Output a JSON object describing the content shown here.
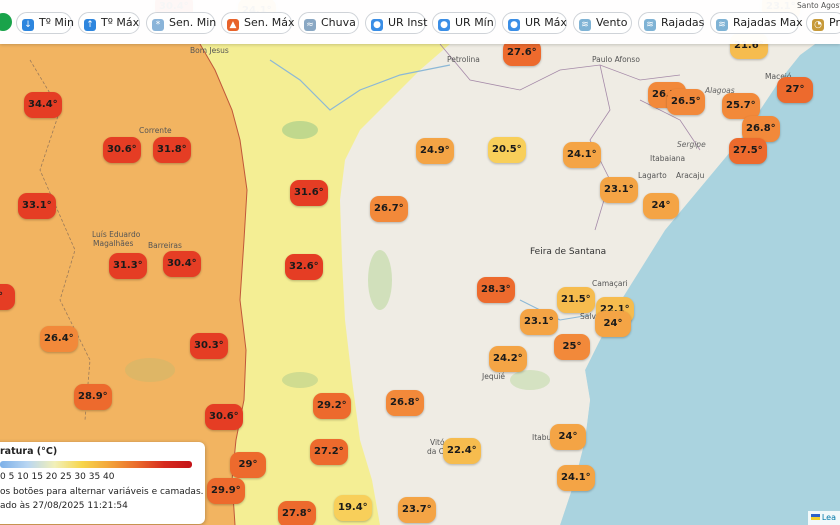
{
  "toolbar": {
    "buttons": [
      {
        "label": "Tº Min",
        "icon": "thermometer-down-icon"
      },
      {
        "label": "Tº Máx",
        "icon": "thermometer-up-icon"
      },
      {
        "label": "Sen. Min",
        "icon": "snowflake-icon"
      },
      {
        "label": "Sen. Máx",
        "icon": "fire-icon"
      },
      {
        "label": "Chuva",
        "icon": "rain-cloud-icon"
      },
      {
        "label": "UR Inst",
        "icon": "water-drop-icon"
      },
      {
        "label": "UR Mín",
        "icon": "water-drop-icon"
      },
      {
        "label": "UR Máx",
        "icon": "water-drop-icon"
      },
      {
        "label": "Vento",
        "icon": "wind-icon"
      },
      {
        "label": "Rajadas",
        "icon": "wind-icon"
      },
      {
        "label": "Rajadas Max",
        "icon": "wind-icon"
      },
      {
        "label": "Pre",
        "icon": "gauge-icon"
      }
    ]
  },
  "markers": [
    {
      "value": "30.4°",
      "temp": 30.4
    },
    {
      "value": "24.1°",
      "temp": 24.1
    },
    {
      "value": "27.6°",
      "temp": 27.6
    },
    {
      "value": "21.6°",
      "temp": 21.6
    },
    {
      "value": "23.1°",
      "temp": 23.1
    },
    {
      "value": "34.4°",
      "temp": 34.4
    },
    {
      "value": "26.7°",
      "temp": 26.7
    },
    {
      "value": "26.5°",
      "temp": 26.5
    },
    {
      "value": "25.7°",
      "temp": 25.7
    },
    {
      "value": "27°",
      "temp": 27.0
    },
    {
      "value": "26.8°",
      "temp": 26.8
    },
    {
      "value": "30.6°",
      "temp": 30.6
    },
    {
      "value": "31.8°",
      "temp": 31.8
    },
    {
      "value": "24.9°",
      "temp": 24.9
    },
    {
      "value": "20.5°",
      "temp": 20.5
    },
    {
      "value": "24.1°",
      "temp": 24.1
    },
    {
      "value": "27.5°",
      "temp": 27.5
    },
    {
      "value": "23.1°",
      "temp": 23.1
    },
    {
      "value": "24°",
      "temp": 24.0
    },
    {
      "value": "31.6°",
      "temp": 31.6
    },
    {
      "value": "33.1°",
      "temp": 33.1
    },
    {
      "value": "26.7°",
      "temp": 26.7
    },
    {
      "value": "31.3°",
      "temp": 31.3
    },
    {
      "value": "30.4°",
      "temp": 30.4
    },
    {
      "value": "32.6°",
      "temp": 32.6
    },
    {
      "value": "1°",
      "temp": 31.0
    },
    {
      "value": "28.3°",
      "temp": 28.3
    },
    {
      "value": "21.5°",
      "temp": 21.5
    },
    {
      "value": "22.1°",
      "temp": 22.1
    },
    {
      "value": "23.1°",
      "temp": 23.1
    },
    {
      "value": "24°",
      "temp": 24.0
    },
    {
      "value": "26.4°",
      "temp": 26.4
    },
    {
      "value": "30.3°",
      "temp": 30.3
    },
    {
      "value": "25°",
      "temp": 25.0
    },
    {
      "value": "24.2°",
      "temp": 24.2
    },
    {
      "value": "28.9°",
      "temp": 28.9
    },
    {
      "value": "29.2°",
      "temp": 29.2
    },
    {
      "value": "26.8°",
      "temp": 26.8
    },
    {
      "value": "30.6°",
      "temp": 30.6
    },
    {
      "value": "24°",
      "temp": 24.0
    },
    {
      "value": "22.4°",
      "temp": 22.4
    },
    {
      "value": "27.2°",
      "temp": 27.2
    },
    {
      "value": "29°",
      "temp": 29.0
    },
    {
      "value": "24.1°",
      "temp": 24.1
    },
    {
      "value": "29.9°",
      "temp": 29.9
    },
    {
      "value": "19.4°",
      "temp": 19.4
    },
    {
      "value": "27.8°",
      "temp": 27.8
    },
    {
      "value": "23.7°",
      "temp": 23.7
    }
  ],
  "cities": [
    "Bom Jesus",
    "Petrolina",
    "Paulo Afonso",
    "Maceió",
    "Santo Agost",
    "Alagoas",
    "Sergipe",
    "Itabaiana",
    "Lagarto",
    "Aracaju",
    "Corrente",
    "Luís Eduardo",
    "Magalhães",
    "Barreiras",
    "Feira de Santana",
    "Camaçari",
    "Salv",
    "Jequié",
    "Vitó",
    "da Conq",
    "Itabu"
  ],
  "legend": {
    "title": "ratura (°C)",
    "ticks": "0 5 10 15 20 25 30 35 40",
    "hint": "os botões para alternar variáveis e camadas.",
    "updated": "ado às 27/08/2025 11:21:54"
  },
  "attribution": "Lea"
}
